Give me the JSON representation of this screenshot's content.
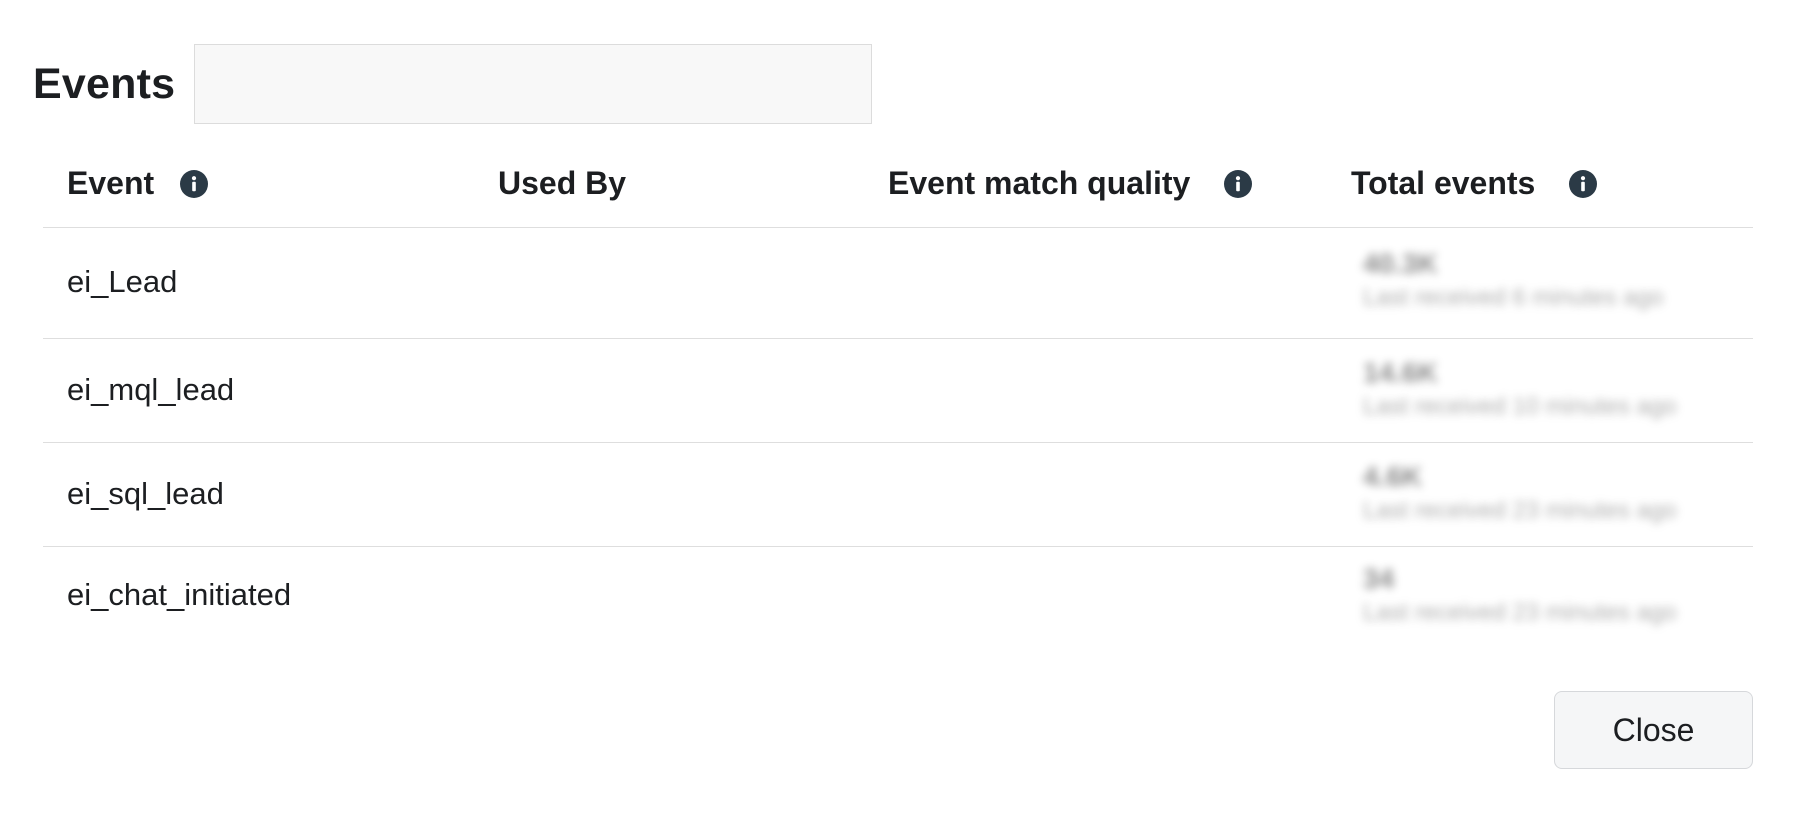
{
  "dialog": {
    "title": "Events",
    "search": {
      "value": "",
      "placeholder": ""
    },
    "close_label": "Close"
  },
  "table": {
    "columns": [
      {
        "label": "Event",
        "has_info": true
      },
      {
        "label": "Used By",
        "has_info": false
      },
      {
        "label": "Event match quality",
        "has_info": true
      },
      {
        "label": "Total events",
        "has_info": true
      }
    ],
    "rows": [
      {
        "event": "ei_Lead",
        "used_by": "",
        "match_quality": "",
        "total": "40.3K",
        "last_received": "Last received 6 minutes ago"
      },
      {
        "event": "ei_mql_lead",
        "used_by": "",
        "match_quality": "",
        "total": "14.6K",
        "last_received": "Last received 10 minutes ago"
      },
      {
        "event": "ei_sql_lead",
        "used_by": "",
        "match_quality": "",
        "total": "4.6K",
        "last_received": "Last received 23 minutes ago"
      },
      {
        "event": "ei_chat_initiated",
        "used_by": "",
        "match_quality": "",
        "total": "34",
        "last_received": "Last received 23 minutes ago"
      }
    ]
  },
  "icons": {
    "info": "info-icon"
  },
  "colors": {
    "text": "#1c1e21",
    "icon": "#2b3a46",
    "divider": "#dedede",
    "search_bg": "#f8f8f8",
    "button_bg": "#f5f6f7"
  }
}
